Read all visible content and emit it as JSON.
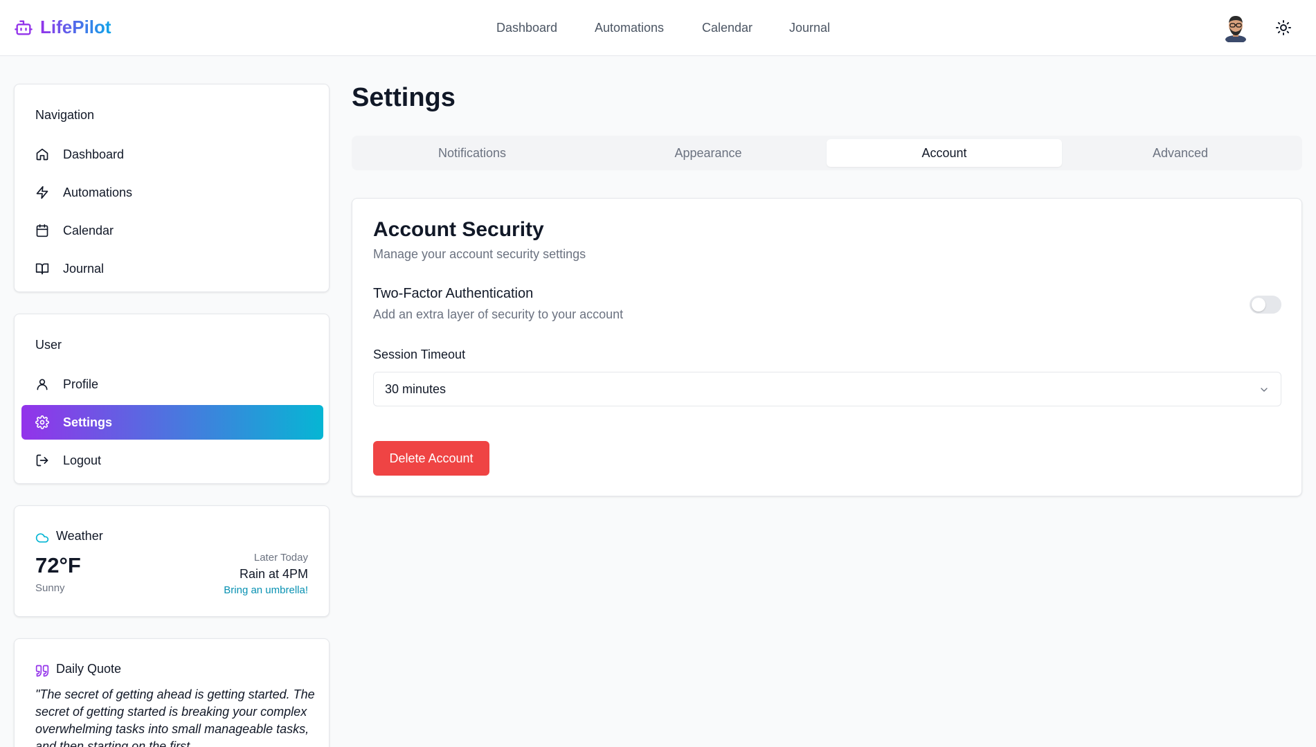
{
  "app": {
    "name": "LifePilot"
  },
  "topnav": [
    {
      "label": "Dashboard"
    },
    {
      "label": "Automations"
    },
    {
      "label": "Calendar"
    },
    {
      "label": "Journal"
    }
  ],
  "sidebar": {
    "navigation": {
      "title": "Navigation",
      "items": [
        {
          "label": "Dashboard",
          "icon": "home-icon"
        },
        {
          "label": "Automations",
          "icon": "bolt-icon"
        },
        {
          "label": "Calendar",
          "icon": "calendar-icon"
        },
        {
          "label": "Journal",
          "icon": "book-icon"
        }
      ]
    },
    "user": {
      "title": "User",
      "items": [
        {
          "label": "Profile",
          "icon": "user-icon"
        },
        {
          "label": "Settings",
          "icon": "gear-icon",
          "active": true
        },
        {
          "label": "Logout",
          "icon": "logout-icon"
        }
      ]
    },
    "weather": {
      "title": "Weather",
      "temp": "72°F",
      "condition": "Sunny",
      "later_label": "Later Today",
      "later_forecast": "Rain at 4PM",
      "tip": "Bring an umbrella!"
    },
    "quote": {
      "title": "Daily Quote",
      "text": "\"The secret of getting ahead is getting started. The secret of getting started is breaking your complex overwhelming tasks into small manageable tasks, and then starting on the first"
    }
  },
  "main": {
    "title": "Settings",
    "tabs": [
      {
        "label": "Notifications"
      },
      {
        "label": "Appearance"
      },
      {
        "label": "Account",
        "active": true
      },
      {
        "label": "Advanced"
      }
    ],
    "account_security": {
      "title": "Account Security",
      "subtitle": "Manage your account security settings",
      "two_factor": {
        "title": "Two-Factor Authentication",
        "subtitle": "Add an extra layer of security to your account",
        "enabled": false
      },
      "session_timeout": {
        "label": "Session Timeout",
        "value": "30 minutes"
      },
      "delete_label": "Delete Account"
    }
  },
  "colors": {
    "accent_start": "#9333ea",
    "accent_end": "#06b6d4",
    "danger": "#ef4444",
    "link": "#0891b2"
  }
}
